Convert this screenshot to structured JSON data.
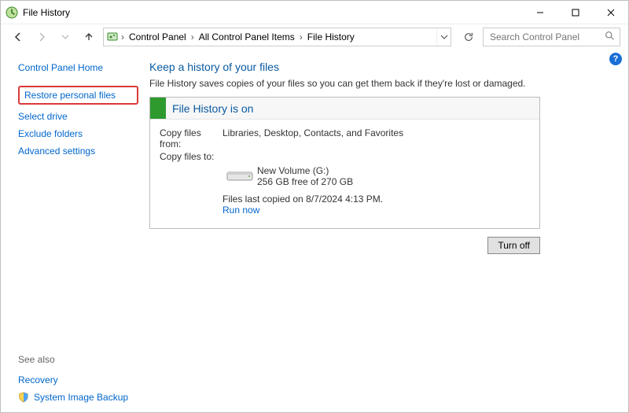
{
  "window": {
    "title": "File History"
  },
  "breadcrumb": {
    "items": [
      "Control Panel",
      "All Control Panel Items",
      "File History"
    ]
  },
  "search": {
    "placeholder": "Search Control Panel"
  },
  "sidebar": {
    "home": "Control Panel Home",
    "restore": "Restore personal files",
    "select_drive": "Select drive",
    "exclude": "Exclude folders",
    "advanced": "Advanced settings"
  },
  "seealso": {
    "label": "See also",
    "recovery": "Recovery",
    "sysimg": "System Image Backup"
  },
  "main": {
    "heading": "Keep a history of your files",
    "subtitle": "File History saves copies of your files so you can get them back if they're lost or damaged.",
    "status_title": "File History is on",
    "copy_from_label": "Copy files from:",
    "copy_from_value": "Libraries, Desktop, Contacts, and Favorites",
    "copy_to_label": "Copy files to:",
    "drive_name": "New Volume (G:)",
    "drive_free": "256 GB free of 270 GB",
    "last_copied": "Files last copied on 8/7/2024 4:13 PM.",
    "run_now": "Run now",
    "turn_off": "Turn off"
  }
}
